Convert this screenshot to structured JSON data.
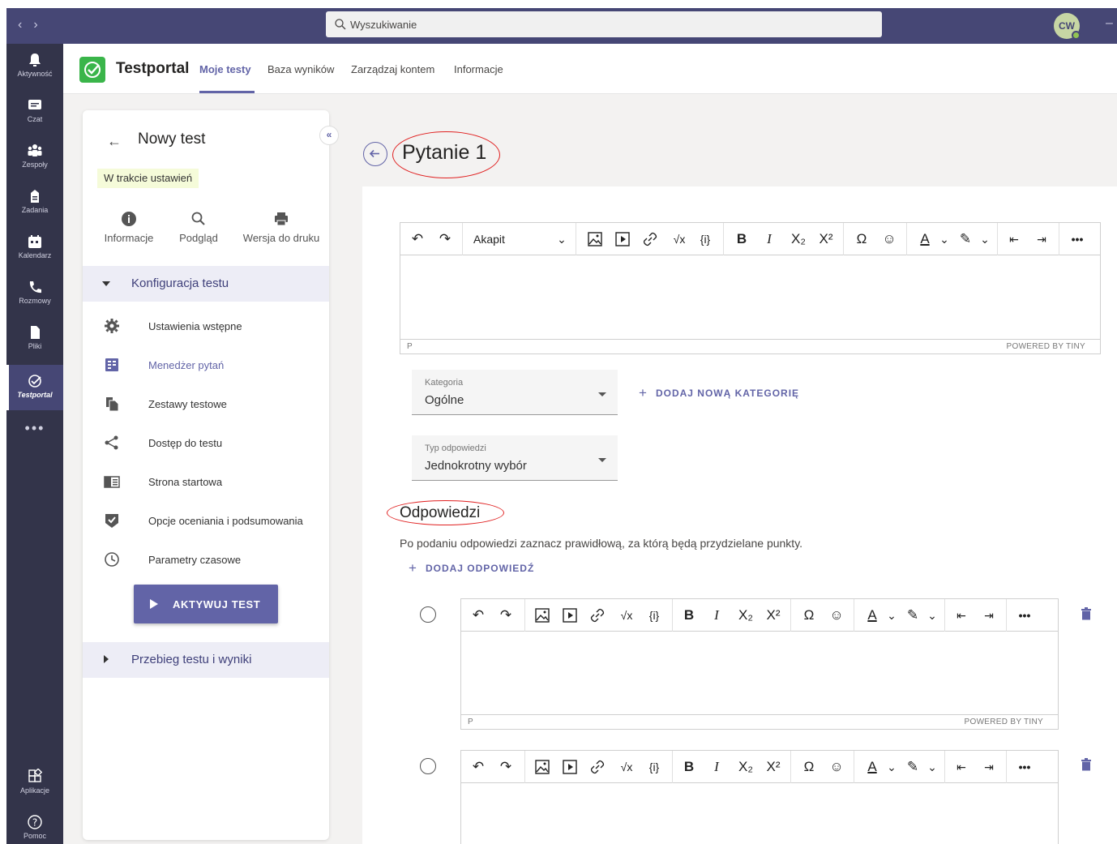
{
  "search": {
    "placeholder": "Wyszukiwanie"
  },
  "user": {
    "initials": "CW"
  },
  "rail": {
    "items": [
      {
        "label": "Aktywność",
        "icon": "bell-icon"
      },
      {
        "label": "Czat",
        "icon": "chat-icon"
      },
      {
        "label": "Zespoły",
        "icon": "teams-icon"
      },
      {
        "label": "Zadania",
        "icon": "assignments-icon"
      },
      {
        "label": "Kalendarz",
        "icon": "calendar-icon"
      },
      {
        "label": "Rozmowy",
        "icon": "phone-icon"
      },
      {
        "label": "Pliki",
        "icon": "file-icon"
      },
      {
        "label": "Testportal",
        "icon": "testportal-icon"
      }
    ],
    "more": "•••",
    "apps": "Aplikacje",
    "help": "Pomoc"
  },
  "app": {
    "title": "Testportal",
    "tabs": [
      "Moje testy",
      "Baza wyników",
      "Zarządzaj kontem",
      "Informacje"
    ]
  },
  "panel": {
    "title": "Nowy test",
    "status": "W trakcie ustawień",
    "collapse": "«",
    "actions": [
      "Informacje",
      "Podgląd",
      "Wersja do druku"
    ],
    "section1": "Konfiguracja testu",
    "items": [
      "Ustawienia wstępne",
      "Menedżer pytań",
      "Zestawy testowe",
      "Dostęp do testu",
      "Strona startowa",
      "Opcje oceniania i podsumowania",
      "Parametry czasowe"
    ],
    "activate": "AKTYWUJ TEST",
    "section2": "Przebieg testu i wyniki"
  },
  "main": {
    "title": "Pytanie 1",
    "editor": {
      "format": "Akapit",
      "path": "P",
      "powered": "POWERED BY TINY"
    },
    "category": {
      "label": "Kategoria",
      "value": "Ogólne"
    },
    "add_category": "DODAJ NOWĄ KATEGORIĘ",
    "answer_type": {
      "label": "Typ odpowiedzi",
      "value": "Jednokrotny wybór"
    },
    "answers_heading": "Odpowiedzi",
    "helper": "Po podaniu odpowiedzi zaznacz prawidłową, za którą będą przydzielane punkty.",
    "add_answer": "DODAJ ODPOWIEDŹ"
  },
  "colors": {
    "accent": "#6264a7",
    "topbar": "#464775",
    "rail": "#33344a",
    "annotation": "#e02020",
    "logo": "#3ab54a"
  }
}
